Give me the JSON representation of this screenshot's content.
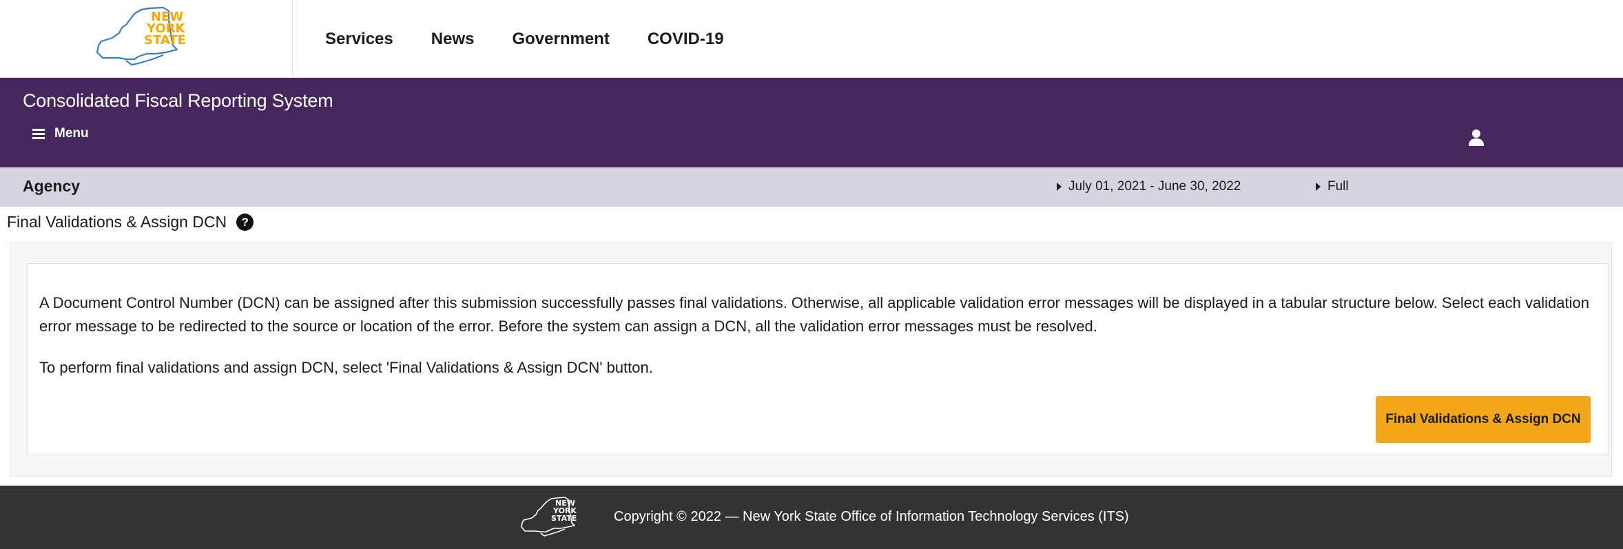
{
  "brand": {
    "logo_lines": [
      "NEW",
      "YORK",
      "STATE"
    ],
    "logo_color": "#f2a900",
    "outline_color": "#3a7dc3"
  },
  "top_nav": {
    "items": [
      "Services",
      "News",
      "Government",
      "COVID-19"
    ]
  },
  "app_bar": {
    "title": "Consolidated Fiscal Reporting System",
    "menu_label": "Menu",
    "menu_icon": "hamburger-icon",
    "user_icon": "user-icon",
    "color": "#45275e"
  },
  "context_bar": {
    "agency_label": "Agency",
    "period": "July 01, 2021 - June 30, 2022",
    "submission_type": "Full"
  },
  "page": {
    "title": "Final Validations & Assign DCN",
    "help_icon_glyph": "?"
  },
  "content": {
    "paragraph_1": "A Document Control Number (DCN) can be assigned after this submission successfully passes final validations. Otherwise, all applicable validation error messages will be displayed in a tabular structure below. Select each validation error message to be redirected to the source or location of the error. Before the system can assign a DCN, all the validation error messages must be resolved.",
    "paragraph_2": "To perform final validations and assign DCN, select 'Final Validations & Assign DCN' button.",
    "button_label": "Final Validations & Assign DCN",
    "button_color": "#f3a619"
  },
  "footer": {
    "logo_lines": [
      "NEW",
      "YORK",
      "STATE"
    ],
    "copyright": "Copyright © 2022 — New York State Office of Information Technology Services (ITS)",
    "color": "#333333"
  }
}
